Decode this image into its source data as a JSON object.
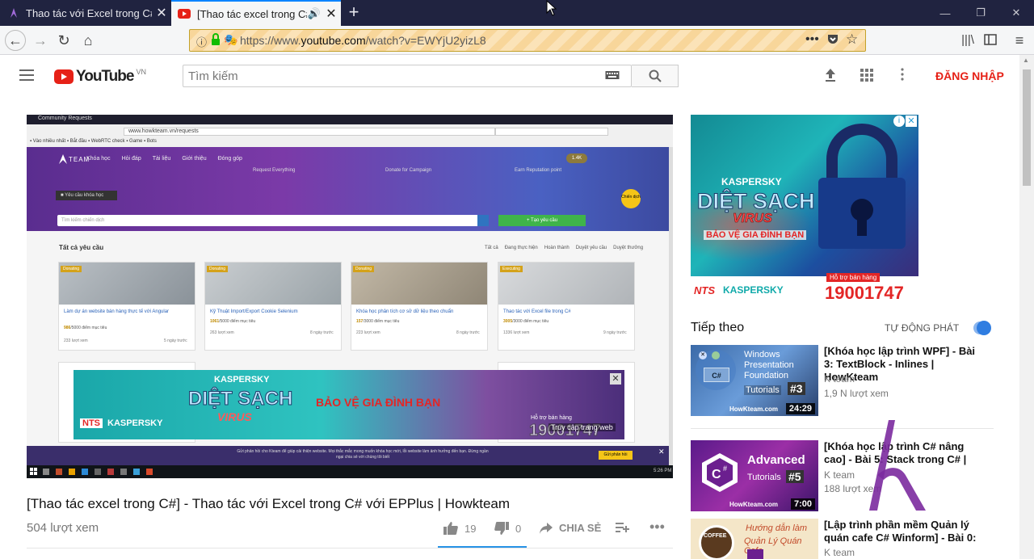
{
  "browser": {
    "tabs": [
      {
        "title": "Thao tác với Excel trong C#",
        "active": false
      },
      {
        "title": "[Thao tác excel trong C#] -",
        "active": true
      }
    ],
    "url_prefix": "https://www.",
    "url_domain": "youtube.com",
    "url_path": "/watch?v=EWYjU2yizL8"
  },
  "youtube": {
    "logo_text": "YouTube",
    "region": "VN",
    "search_placeholder": "Tìm kiếm",
    "signin_label": "ĐĂNG NHẬP"
  },
  "video": {
    "title": "[Thao tác excel trong C#] - Thao tác với Excel trong C# với EPPlus | Howkteam",
    "views": "504 lượt xem",
    "likes": "19",
    "dislikes": "0",
    "share_label": "CHIA SẺ"
  },
  "video_frame": {
    "site_url": "www.howkteam.vn/requests",
    "nav": [
      "Khóa học",
      "Hỏi đáp",
      "Tài liệu",
      "Giới thiệu",
      "Đóng góp"
    ],
    "banner_cols": [
      "Request Everything",
      "Donate for Campaign",
      "Earn Reputation point"
    ],
    "search_placeholder": "Tìm kiếm chiến dịch",
    "create_btn": "+ Tạo yêu cầu",
    "section_title": "Tất cả yêu cầu",
    "filters": [
      "Tất cả",
      "Đang thực hiện",
      "Hoàn thành",
      "Duyệt yêu cầu",
      "Duyệt thưởng"
    ],
    "cards": [
      {
        "title": "Làm dự án website bán hàng thực tế với Angular",
        "points": "986",
        "total": "/5000 điểm mục tiêu",
        "views": "233 lượt xem",
        "time": "5 ngày trước"
      },
      {
        "title": "Kỹ Thuật Import/Export Cookie Selenium",
        "points": "1061",
        "total": "/5000 điểm mục tiêu",
        "views": "263 lượt xem",
        "time": "8 ngày trước"
      },
      {
        "title": "Khóa học phân tích cơ sở dữ liệu theo chuẩn",
        "points": "157",
        "total": "/3000 điểm mục tiêu",
        "views": "223 lượt xem",
        "time": "8 ngày trước"
      },
      {
        "title": "Thao tác với Excel file trong C#",
        "points": "3005",
        "total": "/3000 điểm mục tiêu",
        "views": "1336 lượt xem",
        "time": "9 ngày trước"
      }
    ],
    "badge": "Donating",
    "badge_last": "Executing",
    "ad_slogan": "BẢO VỆ GIA ĐÌNH BẠN",
    "ad_hotline_label": "Hỗ trợ bán hàng",
    "ad_hotline": "19001747",
    "ad_visit": "Truy cập trang web",
    "footer_text": "Gửi phản hồi cho Kteam để giúp cải thiện website. Mọi thắc mắc mong muốn khóa học mới, lỗi website làm ảnh hưởng đến bạn. Đừng ngần ngại chia sẻ với chúng tôi biết",
    "footer_btn": "Gửi phản hồi",
    "clock": "5:26 PM"
  },
  "sidebar": {
    "ad_brand": "KASPERSKY",
    "ad_headline_1": "DIỆT SẠCH",
    "ad_headline_2": "VIRUS",
    "ad_slogan": "BẢO VỆ GIA ĐÌNH BẠN",
    "ad_hotline_label": "Hỗ trợ bán hàng",
    "ad_hotline": "19001747",
    "ad_nts": "NTS",
    "up_next_label": "Tiếp theo",
    "autoplay_label": "TỰ ĐỘNG PHÁT",
    "videos": [
      {
        "title": "[Khóa học lập trình WPF] - Bài 3: TextBlock - Inlines | HowKteam",
        "channel": "K team",
        "views": "1,9 N lượt xem",
        "duration": "24:29",
        "thumb_line1": "Windows",
        "thumb_line2": "Presentation",
        "thumb_line3": "Foundation",
        "thumb_tag": "Tutorials",
        "thumb_num": "#3",
        "thumb_site": "HowKteam.com"
      },
      {
        "title": "[Khóa học lập trình C# nâng cao] - Bài 5: Stack trong C# |",
        "channel": "K team",
        "views": "188 lượt xem",
        "duration": "7:00",
        "thumb_line1": "Advanced",
        "thumb_tag": "Tutorials",
        "thumb_num": "#5",
        "thumb_site": "HowKteam.com"
      },
      {
        "title": "[Lập trình phần mềm Quản lý quán cafe C# Winform] - Bài 0:",
        "channel": "K team",
        "thumb_line1": "Hướng dẫn làm",
        "thumb_line2": "Quản Lý Quán Cafe",
        "thumb_tag": "COFFEE"
      }
    ]
  }
}
